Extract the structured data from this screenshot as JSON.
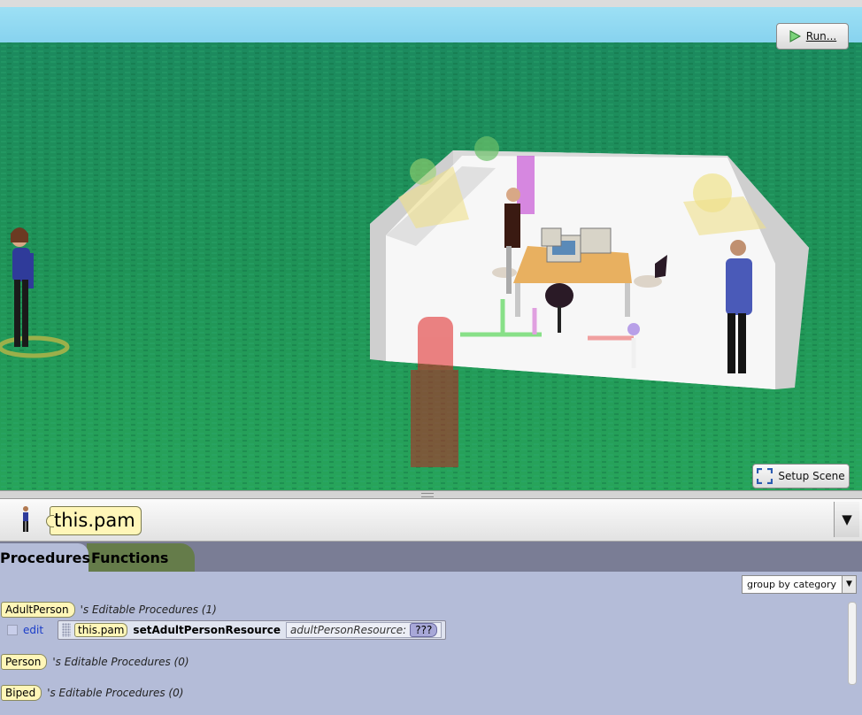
{
  "toolbar": {
    "run_label": "Run...",
    "setup_label": "Setup Scene"
  },
  "selector": {
    "instance_label": "this.pam",
    "dropdown_glyph": "▼"
  },
  "tabs": [
    {
      "label": "Procedures"
    },
    {
      "label": "Functions"
    }
  ],
  "group_select": {
    "value": "group by category",
    "arrow": "▼"
  },
  "procedure_groups": [
    {
      "type": "AdultPerson",
      "caption": "'s Editable Procedures (1)"
    },
    {
      "type": "Person",
      "caption": "'s Editable Procedures (0)"
    },
    {
      "type": "Biped",
      "caption": "'s Editable Procedures (0)"
    }
  ],
  "procedure": {
    "edit_label": "edit",
    "target": "this.pam",
    "method": "setAdultPersonResource",
    "param_name": "adultPersonResource:",
    "param_value": "???"
  },
  "colors": {
    "sky": "#8fd8f2",
    "grass": "#1f8c58",
    "panel": "#b4bcd8",
    "tab_active": "#b4bcd8",
    "tab_functions": "#657c4a",
    "chip": "#fff6b8"
  },
  "icons": {
    "run": "play-icon",
    "setup": "fullscreen-icon",
    "selector": "person-thumbnail-icon"
  }
}
